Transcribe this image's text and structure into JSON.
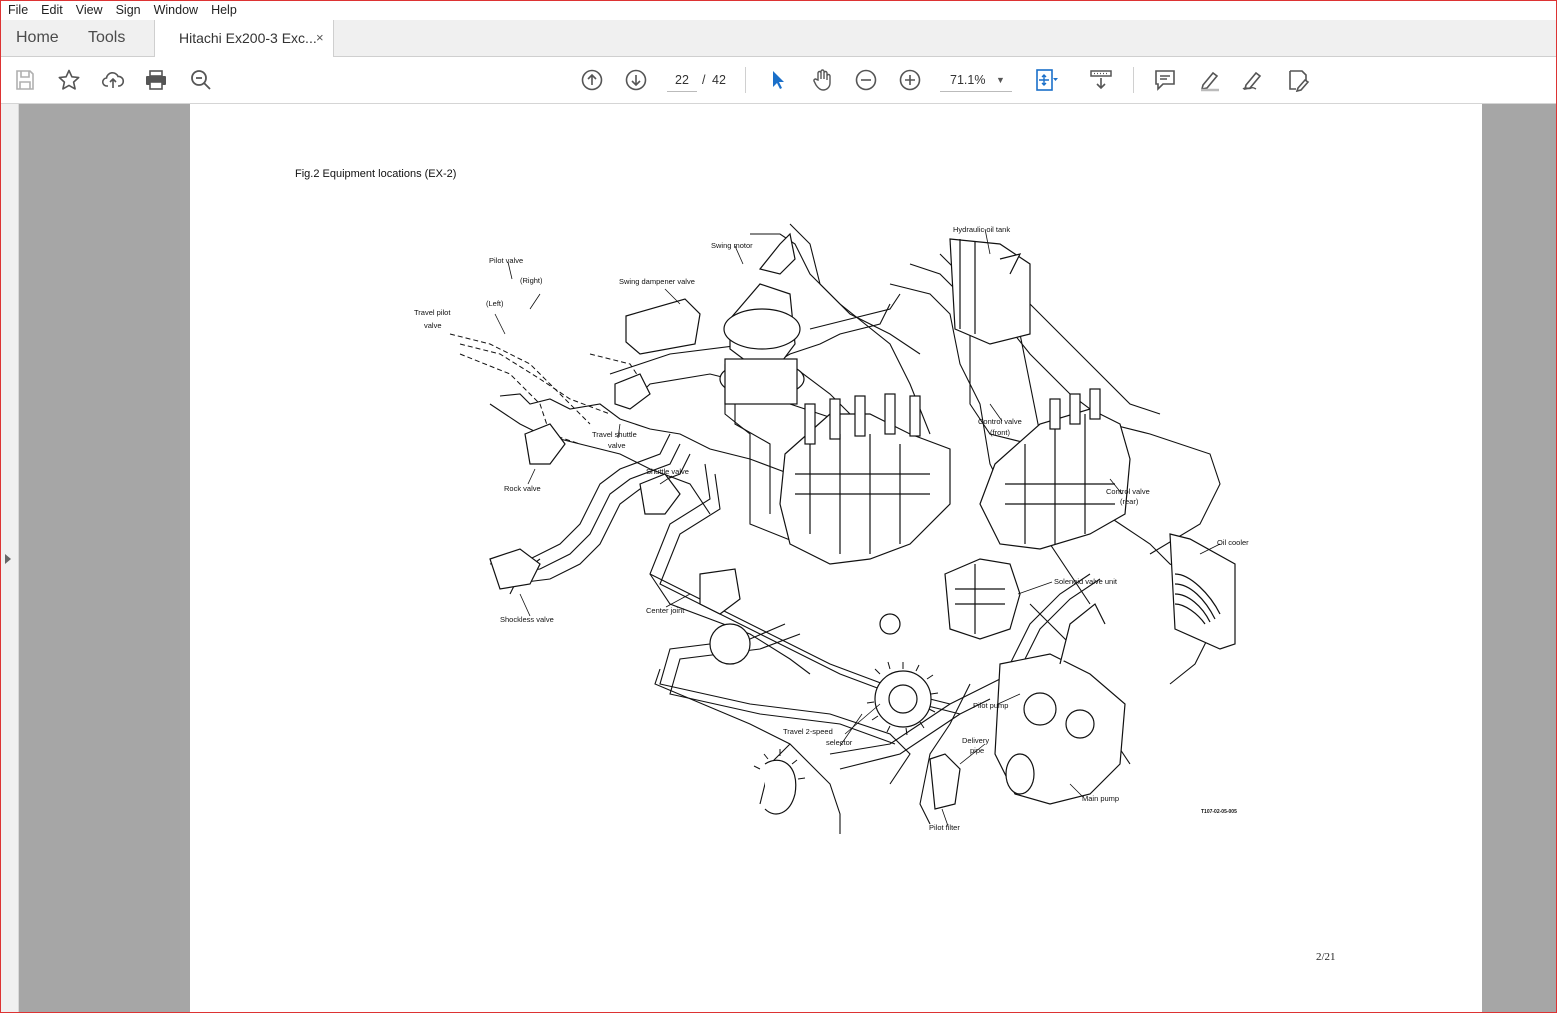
{
  "menu": [
    "File",
    "Edit",
    "View",
    "Sign",
    "Window",
    "Help"
  ],
  "tabs": {
    "home": "Home",
    "tools": "Tools",
    "document": "Hitachi Ex200-3 Exc...",
    "close": "×"
  },
  "toolbar": {
    "page_current": "22",
    "page_separator": "/",
    "page_total": "42",
    "zoom": "71.1%"
  },
  "page": {
    "caption": "Fig.2  Equipment locations (EX-2)",
    "page_number": "2/21",
    "figure_code": "T107-02-05-005",
    "labels": {
      "pilot_valve": "Pilot valve",
      "right": "(Right)",
      "left": "(Left)",
      "travel_pilot": "Travel pilot",
      "valve": "valve",
      "swing_motor": "Swing motor",
      "swing_dampener": "Swing dampener valve",
      "hydraulic_tank": "Hydraulic oil tank",
      "control_valve": "Control valve",
      "front": "(front)",
      "travel_shuttle": "Travel shuttle",
      "valve2": "valve",
      "shuttle_valve": "Shuttle valve",
      "rock_valve": "Rock valve",
      "control_valve_rear": "Control valve",
      "rear": "(rear)",
      "oil_cooler": "Oil cooler",
      "solenoid": "Solenoid valve unit",
      "center_joint": "Center joint",
      "shockless": "Shockless valve",
      "pilot_pump": "Pilot pump",
      "delivery": "Delivery",
      "pipe": "pipe",
      "travel_2speed": "Travel 2-speed",
      "selector": "selector",
      "main_pump": "Main pump",
      "pilot_filter": "Pilot filter"
    }
  }
}
